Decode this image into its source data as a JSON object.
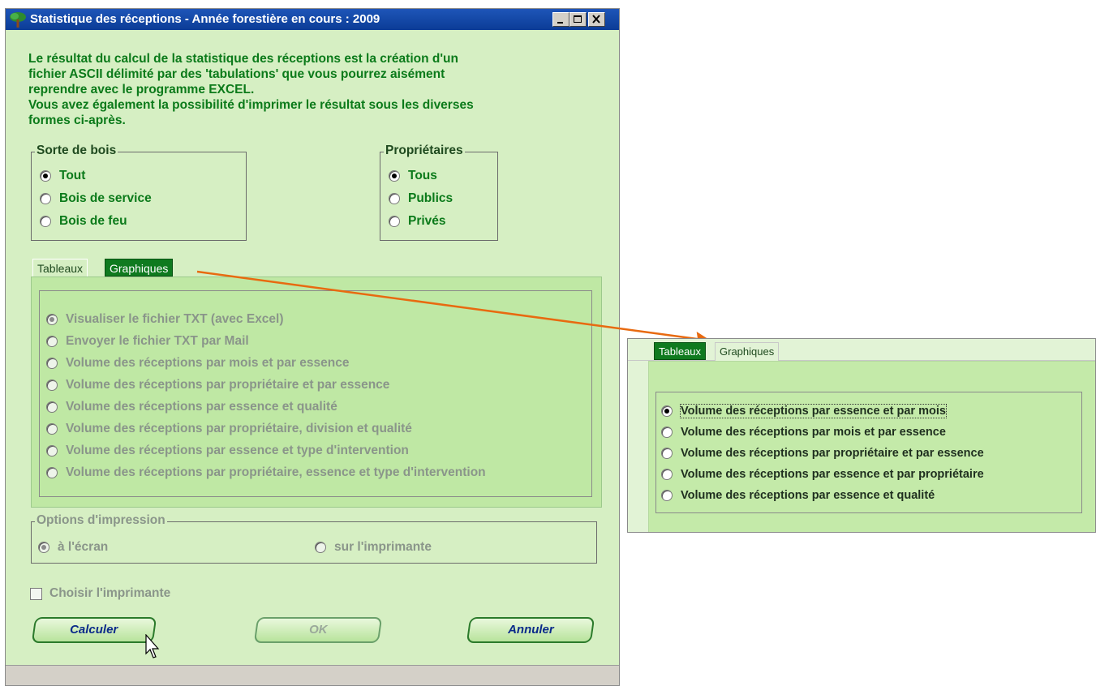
{
  "window": {
    "title": "Statistique des réceptions  -  Année forestière en cours : 2009"
  },
  "intro": [
    "Le résultat du calcul de la statistique des réceptions est la création d'un",
    "fichier ASCII délimité par des 'tabulations' que vous pourrez aisément",
    "reprendre avec le programme EXCEL.",
    "Vous avez également la possibilité d'imprimer le résultat sous les diverses",
    "formes ci-après."
  ],
  "sorte_de_bois": {
    "legend": "Sorte de bois",
    "options": [
      "Tout",
      "Bois de service",
      "Bois de feu"
    ],
    "selected": "Tout"
  },
  "proprietaires": {
    "legend": "Propriétaires",
    "options": [
      "Tous",
      "Publics",
      "Privés"
    ],
    "selected": "Tous"
  },
  "tabs": {
    "tableaux": "Tableaux",
    "graphiques": "Graphiques"
  },
  "tableaux_options": [
    "Visualiser le fichier TXT (avec Excel)",
    "Envoyer le fichier TXT par Mail",
    "Volume des réceptions par mois et par essence",
    "Volume des réceptions par propriétaire et par essence",
    "Volume des réceptions par essence et qualité",
    "Volume des réceptions par propriétaire, division et qualité",
    "Volume des réceptions par essence et type d'intervention",
    "Volume des réceptions par propriétaire, essence et type d'intervention"
  ],
  "impression": {
    "legend": "Options d'impression",
    "ecran": "à l'écran",
    "imprimante": "sur l'imprimante"
  },
  "choisir_imprimante": "Choisir l'imprimante",
  "buttons": {
    "calculer": "Calculer",
    "ok": "OK",
    "annuler": "Annuler"
  },
  "graphiques_options": [
    "Volume des réceptions par essence et par mois",
    "Volume des réceptions par  mois et par essence",
    "Volume des réceptions par propriétaire et par essence",
    "Volume des réceptions par essence et par propriétaire",
    "Volume des réceptions par essence et qualité"
  ],
  "colors": {
    "accent_green": "#0b7a1a",
    "arrow": "#e86a10",
    "titlebar": "#0b3c96"
  }
}
